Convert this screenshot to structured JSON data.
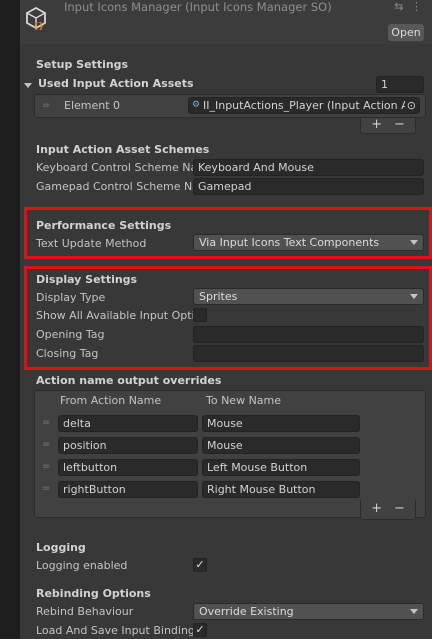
{
  "header": {
    "title": "Input Icons Manager (Input Icons Manager SO)",
    "open_label": "Open",
    "header_icons": "⇆ ⋮"
  },
  "setup": {
    "heading": "Setup Settings",
    "used_assets_label": "Used Input Action Assets",
    "used_assets_count": "1",
    "element_label": "Element 0",
    "element_value": "II_InputActions_Player (Input Action As"
  },
  "schemes": {
    "heading": "Input Action Asset Schemes",
    "keyboard_label": "Keyboard Control Scheme Na",
    "keyboard_value": "Keyboard And Mouse",
    "gamepad_label": "Gamepad Control Scheme Na",
    "gamepad_value": "Gamepad"
  },
  "performance": {
    "heading": "Performance Settings",
    "text_update_label": "Text Update Method",
    "text_update_value": "Via Input Icons Text Components"
  },
  "display": {
    "heading": "Display Settings",
    "display_type_label": "Display Type",
    "display_type_value": "Sprites",
    "show_all_label": "Show All Available Input Optio",
    "opening_tag_label": "Opening Tag",
    "opening_tag_value": "",
    "closing_tag_label": "Closing Tag",
    "closing_tag_value": ""
  },
  "overrides": {
    "heading": "Action name output overrides",
    "col_from": "From Action Name",
    "col_to": "To New Name",
    "rows": [
      {
        "from": "delta",
        "to": "Mouse"
      },
      {
        "from": "position",
        "to": "Mouse"
      },
      {
        "from": "leftbutton",
        "to": "Left Mouse Button"
      },
      {
        "from": "rightButton",
        "to": "Right  Mouse Button"
      }
    ]
  },
  "logging": {
    "heading": "Logging",
    "enabled_label": "Logging enabled",
    "enabled": true
  },
  "rebinding": {
    "heading": "Rebinding Options",
    "behaviour_label": "Rebind Behaviour",
    "behaviour_value": "Override Existing",
    "load_save_label": "Load And Save Input Binding (",
    "load_save": true
  },
  "glyphs": {
    "plus": "+",
    "minus": "−",
    "check": "✓",
    "handle": "=",
    "target": "⊙",
    "asset": "⚙"
  },
  "colors": {
    "highlight": "#e0101a",
    "panel": "#383838",
    "field": "#2a2a2a",
    "dropdown": "#515151"
  }
}
